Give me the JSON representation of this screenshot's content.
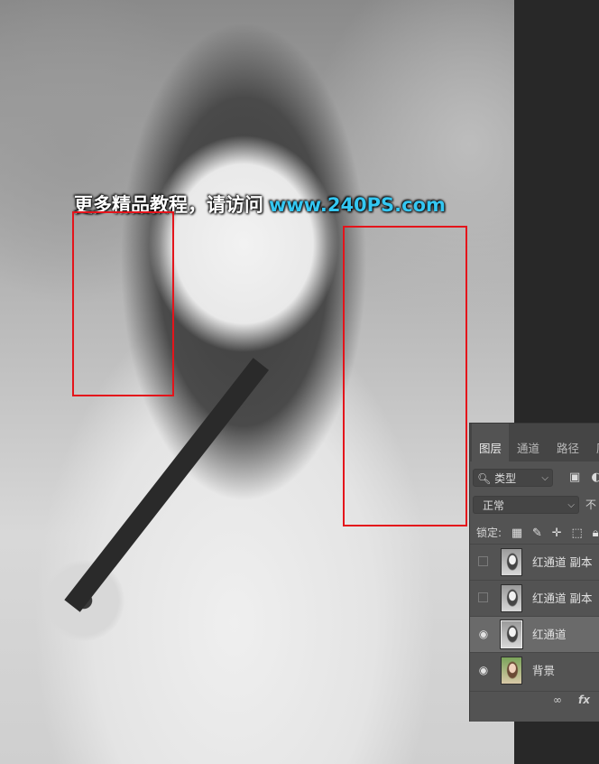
{
  "photo": {
    "watermark": {
      "chinese_text": "更多精品教程，请访问",
      "url_text": "www.240PS.com",
      "url_color": "#34c7f2"
    },
    "highlight_color": "#e4141b"
  },
  "layers_panel": {
    "tabs": [
      {
        "label": "图层",
        "active": true
      },
      {
        "label": "通道",
        "active": false
      },
      {
        "label": "路径",
        "active": false
      },
      {
        "label": "历",
        "active": false
      }
    ],
    "filter": {
      "icon": "search-icon",
      "value": "类型"
    },
    "filter_icons": [
      "image-icon",
      "adjustment-icon"
    ],
    "blend_mode": "正常",
    "opacity_label": "不",
    "lock": {
      "label": "锁定:",
      "icons": [
        "lock-transparent-pixels-icon",
        "lock-image-pixels-icon",
        "lock-position-icon",
        "lock-artboard-icon",
        "lock-all-icon"
      ]
    },
    "layers": [
      {
        "name": "红通道 副本",
        "visible": false,
        "selected": false,
        "thumb": "grayscale"
      },
      {
        "name": "红通道 副本",
        "visible": false,
        "selected": false,
        "thumb": "grayscale"
      },
      {
        "name": "红通道",
        "visible": true,
        "selected": true,
        "thumb": "grayscale"
      },
      {
        "name": "背景",
        "visible": true,
        "selected": false,
        "thumb": "color"
      }
    ],
    "bottom_icons": [
      "link-layers-icon",
      "fx-icon"
    ],
    "fx_label": "fx"
  }
}
